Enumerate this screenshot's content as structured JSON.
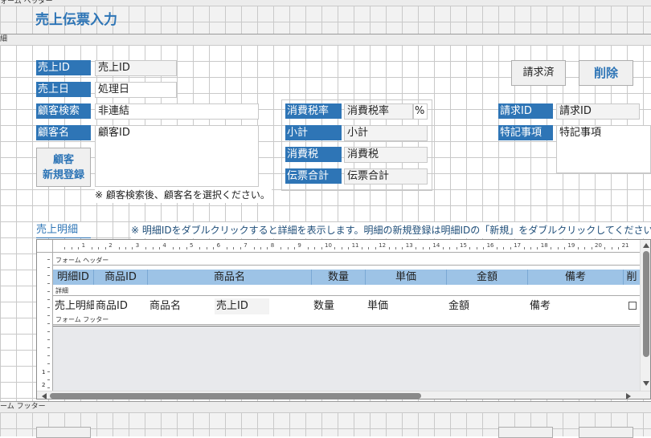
{
  "form_header_bar": "ォーム ヘッダー",
  "detail_bar": "細",
  "form_footer_bar": "ーム フッター",
  "title": "売上伝票入力",
  "fields": {
    "sales_id_label": "売上ID",
    "sales_id_value": "売上ID",
    "sales_date_label": "売上日",
    "sales_date_value": "処理日",
    "customer_search_label": "顧客検索",
    "customer_search_value": "非連結",
    "customer_name_label": "顧客名",
    "customer_name_value": "顧客ID",
    "tax_rate_label": "消費税率",
    "tax_rate_value": "消費税率",
    "tax_rate_unit": "%",
    "subtotal_label": "小計",
    "subtotal_value": "小計",
    "tax_label": "消費税",
    "tax_value": "消費税",
    "total_label": "伝票合計",
    "total_value": "伝票合計",
    "invoice_id_label": "請求ID",
    "invoice_id_value": "請求ID",
    "notes_label": "特記事項",
    "notes_value": "特記事項"
  },
  "buttons": {
    "new_customer_line1": "顧客",
    "new_customer_line2": "新規登録",
    "invoiced": "請求済",
    "delete": "削除"
  },
  "hint_customer": "※ 顧客検索後、顧客名を選択ください。",
  "details": {
    "label": "売上明細",
    "hint": "※ 明細IDをダブルクリックすると詳細を表示します。明細の新規登録は明細IDの「新規」をダブルクリックしてください。",
    "header_bar": "フォーム ヘッダー",
    "detail_bar": "詳細",
    "footer_bar": "フォーム フッター",
    "ruler_ticks": [
      "1",
      "2",
      "3",
      "4",
      "5",
      "6",
      "7",
      "8",
      "9",
      "10",
      "11",
      "12",
      "13",
      "14",
      "15",
      "16",
      "17",
      "18",
      "19",
      "20",
      "21"
    ],
    "vruler_ticks": [
      "1",
      "2"
    ],
    "columns": [
      "明細ID",
      "商品ID",
      "商品名",
      "数量",
      "単価",
      "金額",
      "備考",
      "削"
    ],
    "row": [
      "売上明細",
      "商品ID",
      "商品名",
      "売上ID",
      "数量",
      "単価",
      "金額",
      "備考"
    ]
  }
}
